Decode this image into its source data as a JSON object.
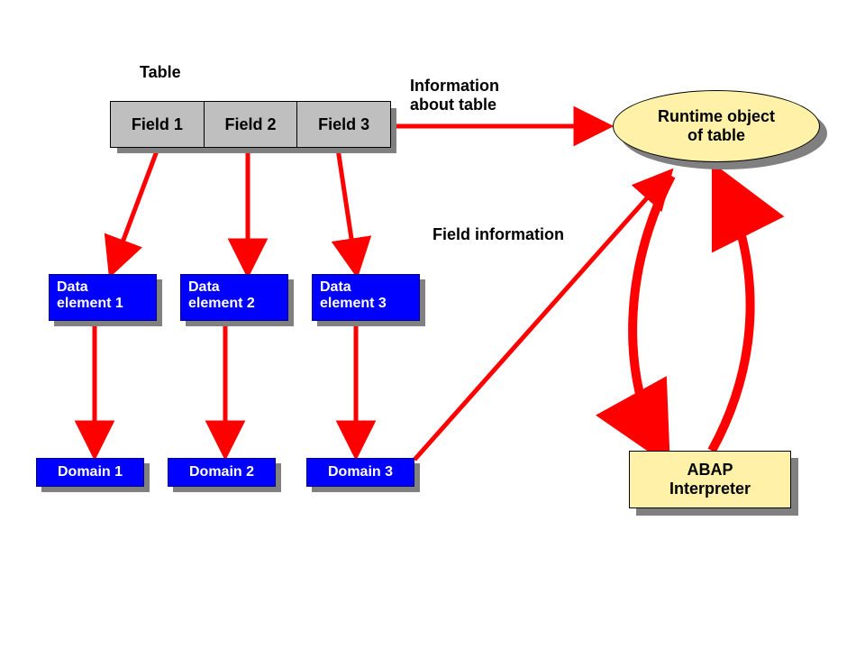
{
  "labels": {
    "table_title": "Table",
    "info_about_table_line1": "Information",
    "info_about_table_line2": "about table",
    "field_information": "Field information"
  },
  "table_fields": {
    "f1": "Field 1",
    "f2": "Field 2",
    "f3": "Field 3"
  },
  "data_elements": {
    "de1_line1": "Data",
    "de1_line2": "element 1",
    "de2_line1": "Data",
    "de2_line2": "element 2",
    "de3_line1": "Data",
    "de3_line2": "element 3"
  },
  "domains": {
    "d1": "Domain 1",
    "d2": "Domain 2",
    "d3": "Domain 3"
  },
  "runtime_object": {
    "line1": "Runtime object",
    "line2": "of table"
  },
  "abap": {
    "line1": "ABAP",
    "line2": "Interpreter"
  },
  "colors": {
    "arrow": "#ff0000",
    "blue": "#0000ff",
    "yellow": "#fff2a8",
    "grey": "#bfbfbf",
    "shadow": "#808080"
  }
}
